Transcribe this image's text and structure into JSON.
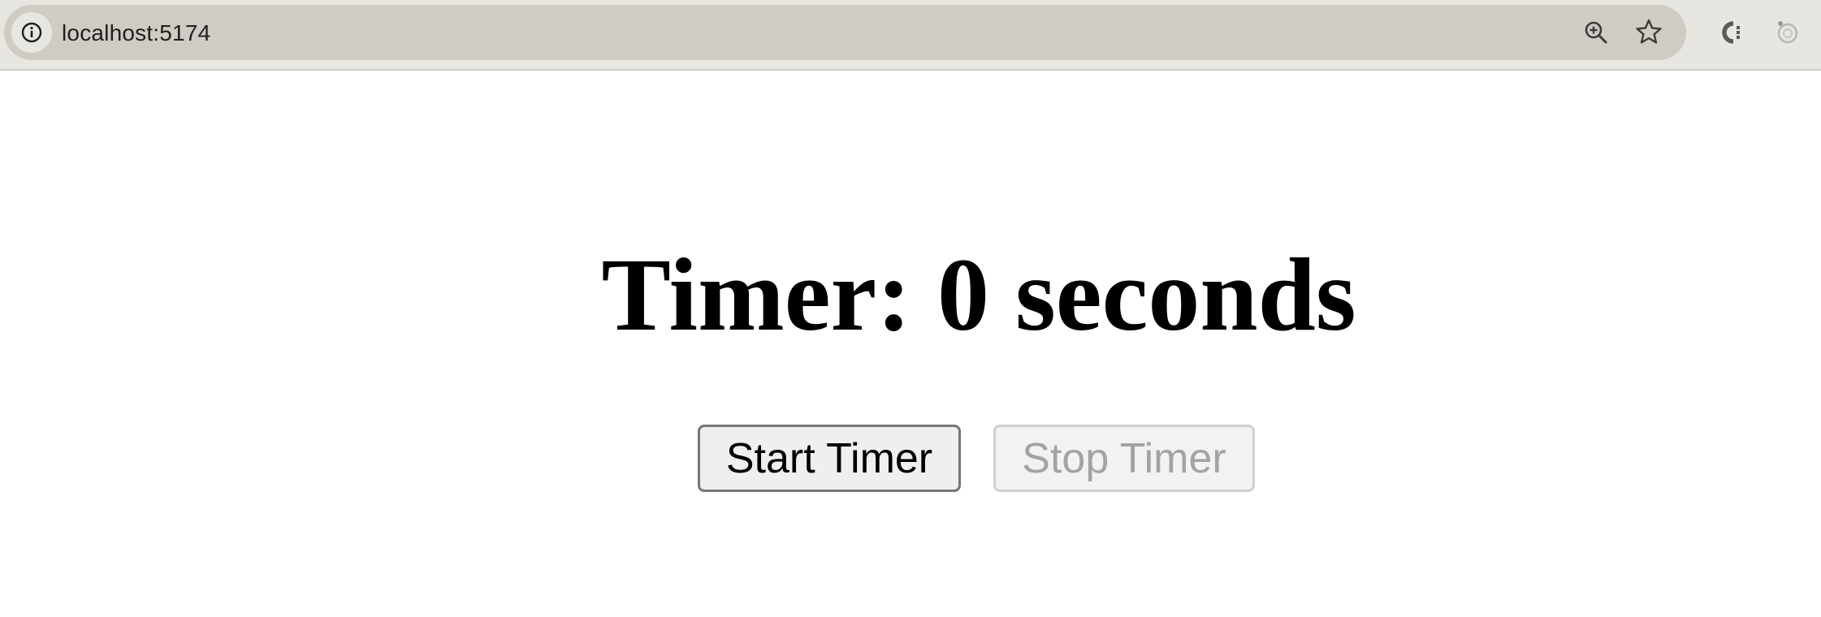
{
  "browser": {
    "url": "localhost:5174",
    "icons": {
      "site_info": "info-icon",
      "zoom": "zoom-in-icon",
      "bookmark": "star-icon",
      "extension_1": "extension-c-icon",
      "extension_2": "extension-circle-icon"
    }
  },
  "page": {
    "heading": "Timer: 0 seconds",
    "start_button_label": "Start Timer",
    "stop_button_label": "Stop Timer",
    "stop_button_disabled": true
  },
  "colors": {
    "chrome_background": "#e8e6e0",
    "address_bar": "#cfccc4",
    "disabled_text": "#a3a3a3",
    "button_background": "#efefef"
  }
}
